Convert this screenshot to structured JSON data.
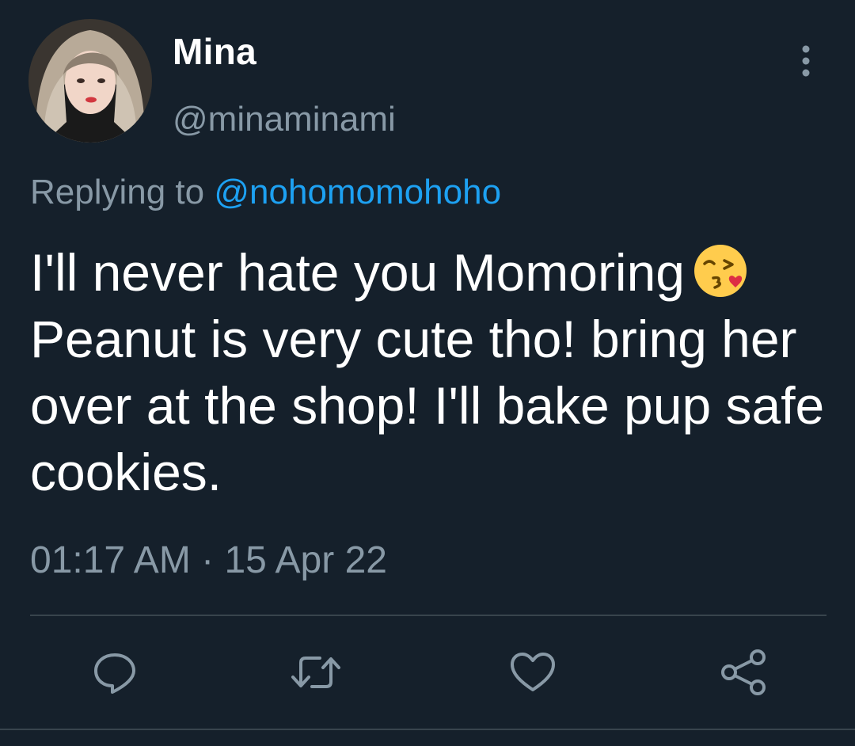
{
  "author": {
    "display_name": "Mina",
    "handle": "@minaminami"
  },
  "reply": {
    "prefix": "Replying to ",
    "mention": "@nohomomohoho"
  },
  "tweet": {
    "line1": "I'll never hate you Momoring",
    "rest": "Peanut is very cute tho! bring her over at the shop! I'll bake pup safe cookies.",
    "emoji": "kissing-face-blowing-heart-emoji"
  },
  "meta": {
    "timestamp": "01:17 AM · 15 Apr 22"
  },
  "actions": [
    {
      "icon": "reply-icon"
    },
    {
      "icon": "retweet-icon"
    },
    {
      "icon": "like-icon"
    },
    {
      "icon": "share-icon"
    }
  ],
  "colors": {
    "background": "#15202b",
    "primary_text": "#ffffff",
    "secondary_text": "#8899a6",
    "link": "#1da1f2",
    "divider": "#38444d"
  }
}
